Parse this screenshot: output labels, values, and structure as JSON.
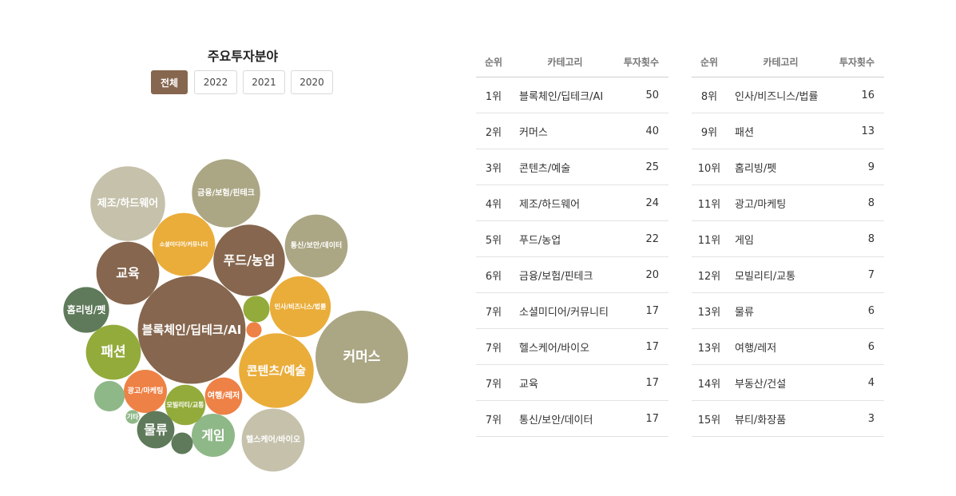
{
  "header": {
    "title": "주요투자분야",
    "filters": [
      "전체",
      "2022",
      "2021",
      "2020"
    ],
    "active_filter": "전체"
  },
  "table": {
    "headers": [
      "순위",
      "카테고리",
      "투자횟수"
    ],
    "left": [
      {
        "rank": "1위",
        "category": "블록체인/딥테크/AI",
        "count": "50"
      },
      {
        "rank": "2위",
        "category": "커머스",
        "count": "40"
      },
      {
        "rank": "3위",
        "category": "콘텐츠/예술",
        "count": "25"
      },
      {
        "rank": "4위",
        "category": "제조/하드웨어",
        "count": "24"
      },
      {
        "rank": "5위",
        "category": "푸드/농업",
        "count": "22"
      },
      {
        "rank": "6위",
        "category": "금융/보험/핀테크",
        "count": "20"
      },
      {
        "rank": "7위",
        "category": "소셜미디어/커뮤니티",
        "count": "17"
      },
      {
        "rank": "7위",
        "category": "헬스케어/바이오",
        "count": "17"
      },
      {
        "rank": "7위",
        "category": "교육",
        "count": "17"
      },
      {
        "rank": "7위",
        "category": "통신/보안/데이터",
        "count": "17"
      }
    ],
    "right": [
      {
        "rank": "8위",
        "category": "인사/비즈니스/법률",
        "count": "16"
      },
      {
        "rank": "9위",
        "category": "패션",
        "count": "13"
      },
      {
        "rank": "10위",
        "category": "홈리빙/펫",
        "count": "9"
      },
      {
        "rank": "11위",
        "category": "광고/마케팅",
        "count": "8"
      },
      {
        "rank": "11위",
        "category": "게임",
        "count": "8"
      },
      {
        "rank": "12위",
        "category": "모빌리티/교통",
        "count": "7"
      },
      {
        "rank": "13위",
        "category": "물류",
        "count": "6"
      },
      {
        "rank": "13위",
        "category": "여행/레저",
        "count": "6"
      },
      {
        "rank": "14위",
        "category": "부동산/건설",
        "count": "4"
      },
      {
        "rank": "15위",
        "category": "뷰티/화장품",
        "count": "3"
      }
    ]
  },
  "colors": {
    "brown": "#86664e",
    "khaki": "#aba684",
    "beige": "#c5c1ab",
    "orange": "#eaad3a",
    "olive": "#93ab3a",
    "dark_green": "#5e7a5a",
    "sage": "#8fb888",
    "coral": "#ee8146"
  },
  "chart_data": {
    "type": "bubble",
    "title": "주요투자분야",
    "series": [
      {
        "label": "블록체인/딥테크/AI",
        "value": 50,
        "color": "#86664e"
      },
      {
        "label": "커머스",
        "value": 40,
        "color": "#aba684"
      },
      {
        "label": "콘텐츠/예술",
        "value": 25,
        "color": "#eaad3a"
      },
      {
        "label": "제조/하드웨어",
        "value": 24,
        "color": "#c5c1ab"
      },
      {
        "label": "푸드/농업",
        "value": 22,
        "color": "#86664e"
      },
      {
        "label": "금융/보험/핀테크",
        "value": 20,
        "color": "#aba684"
      },
      {
        "label": "소셜미디어/커뮤니티",
        "value": 17,
        "color": "#eaad3a"
      },
      {
        "label": "헬스케어/바이오",
        "value": 17,
        "color": "#c5c1ab"
      },
      {
        "label": "교육",
        "value": 17,
        "color": "#86664e"
      },
      {
        "label": "통신/보안/데이터",
        "value": 17,
        "color": "#aba684"
      },
      {
        "label": "인사/비즈니스/법률",
        "value": 16,
        "color": "#eaad3a"
      },
      {
        "label": "패션",
        "value": 13,
        "color": "#93ab3a"
      },
      {
        "label": "홈리빙/펫",
        "value": 9,
        "color": "#5e7a5a"
      },
      {
        "label": "광고/마케팅",
        "value": 8,
        "color": "#ee8146"
      },
      {
        "label": "게임",
        "value": 8,
        "color": "#8fb888"
      },
      {
        "label": "모빌리티/교통",
        "value": 7,
        "color": "#93ab3a"
      },
      {
        "label": "물류",
        "value": 6,
        "color": "#5e7a5a"
      },
      {
        "label": "여행/레저",
        "value": 6,
        "color": "#ee8146"
      },
      {
        "label": "",
        "value": 4,
        "color": "#8fb888"
      },
      {
        "label": "",
        "value": 3,
        "color": "#93ab3a"
      },
      {
        "label": "",
        "value": 2,
        "color": "#5e7a5a"
      },
      {
        "label": "기타",
        "value": 1,
        "color": "#8fb888"
      },
      {
        "label": "",
        "value": 1,
        "color": "#ee8146"
      }
    ]
  }
}
